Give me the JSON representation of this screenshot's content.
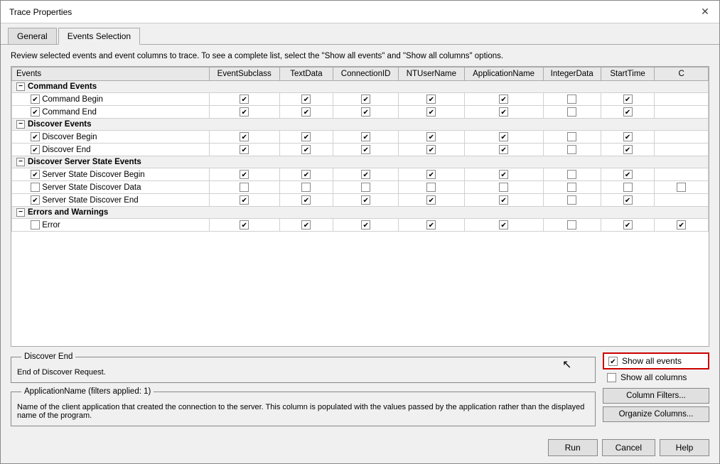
{
  "dialog": {
    "title": "Trace Properties",
    "close_label": "✕"
  },
  "tabs": [
    {
      "id": "general",
      "label": "General",
      "active": false
    },
    {
      "id": "events-selection",
      "label": "Events Selection",
      "active": true
    }
  ],
  "description": "Review selected events and event columns to trace. To see a complete list, select the \"Show all events\" and \"Show all columns\" options.",
  "table": {
    "columns": [
      "Events",
      "EventSubclass",
      "TextData",
      "ConnectionID",
      "NTUserName",
      "ApplicationName",
      "IntegerData",
      "StartTime",
      "C"
    ],
    "groups": [
      {
        "name": "Command Events",
        "collapsed": true,
        "rows": [
          {
            "name": "Command Begin",
            "checked": true,
            "cols": [
              true,
              true,
              true,
              true,
              true,
              false,
              true
            ]
          },
          {
            "name": "Command End",
            "checked": true,
            "cols": [
              true,
              true,
              true,
              true,
              true,
              false,
              true
            ]
          }
        ]
      },
      {
        "name": "Discover Events",
        "collapsed": true,
        "rows": [
          {
            "name": "Discover Begin",
            "checked": true,
            "cols": [
              true,
              true,
              true,
              true,
              true,
              false,
              true
            ]
          },
          {
            "name": "Discover End",
            "checked": true,
            "cols": [
              true,
              true,
              true,
              true,
              true,
              false,
              true
            ]
          }
        ]
      },
      {
        "name": "Discover Server State Events",
        "collapsed": true,
        "rows": [
          {
            "name": "Server State Discover Begin",
            "checked": true,
            "cols": [
              true,
              true,
              true,
              true,
              true,
              false,
              true
            ]
          },
          {
            "name": "Server State Discover Data",
            "checked": false,
            "cols": [
              false,
              false,
              false,
              false,
              false,
              false,
              false
            ]
          },
          {
            "name": "Server State Discover End",
            "checked": true,
            "cols": [
              true,
              true,
              true,
              true,
              true,
              false,
              true
            ]
          }
        ]
      },
      {
        "name": "Errors and Warnings",
        "collapsed": true,
        "rows": [
          {
            "name": "Error",
            "checked": false,
            "cols": [
              true,
              true,
              true,
              true,
              true,
              false,
              true
            ]
          }
        ]
      }
    ]
  },
  "discover_end_panel": {
    "legend": "Discover End",
    "text": "End of Discover Request."
  },
  "app_name_panel": {
    "legend": "ApplicationName (filters applied: 1)",
    "text": "Name of the client application that created the connection to the server. This column is populated with the values passed by the application rather than the displayed name of the program."
  },
  "show_all_events": {
    "label": "Show all events",
    "checked": true
  },
  "show_all_columns": {
    "label": "Show all columns",
    "checked": false
  },
  "buttons": {
    "column_filters": "Column Filters...",
    "organize_columns": "Organize Columns...",
    "run": "Run",
    "cancel": "Cancel",
    "help": "Help"
  }
}
